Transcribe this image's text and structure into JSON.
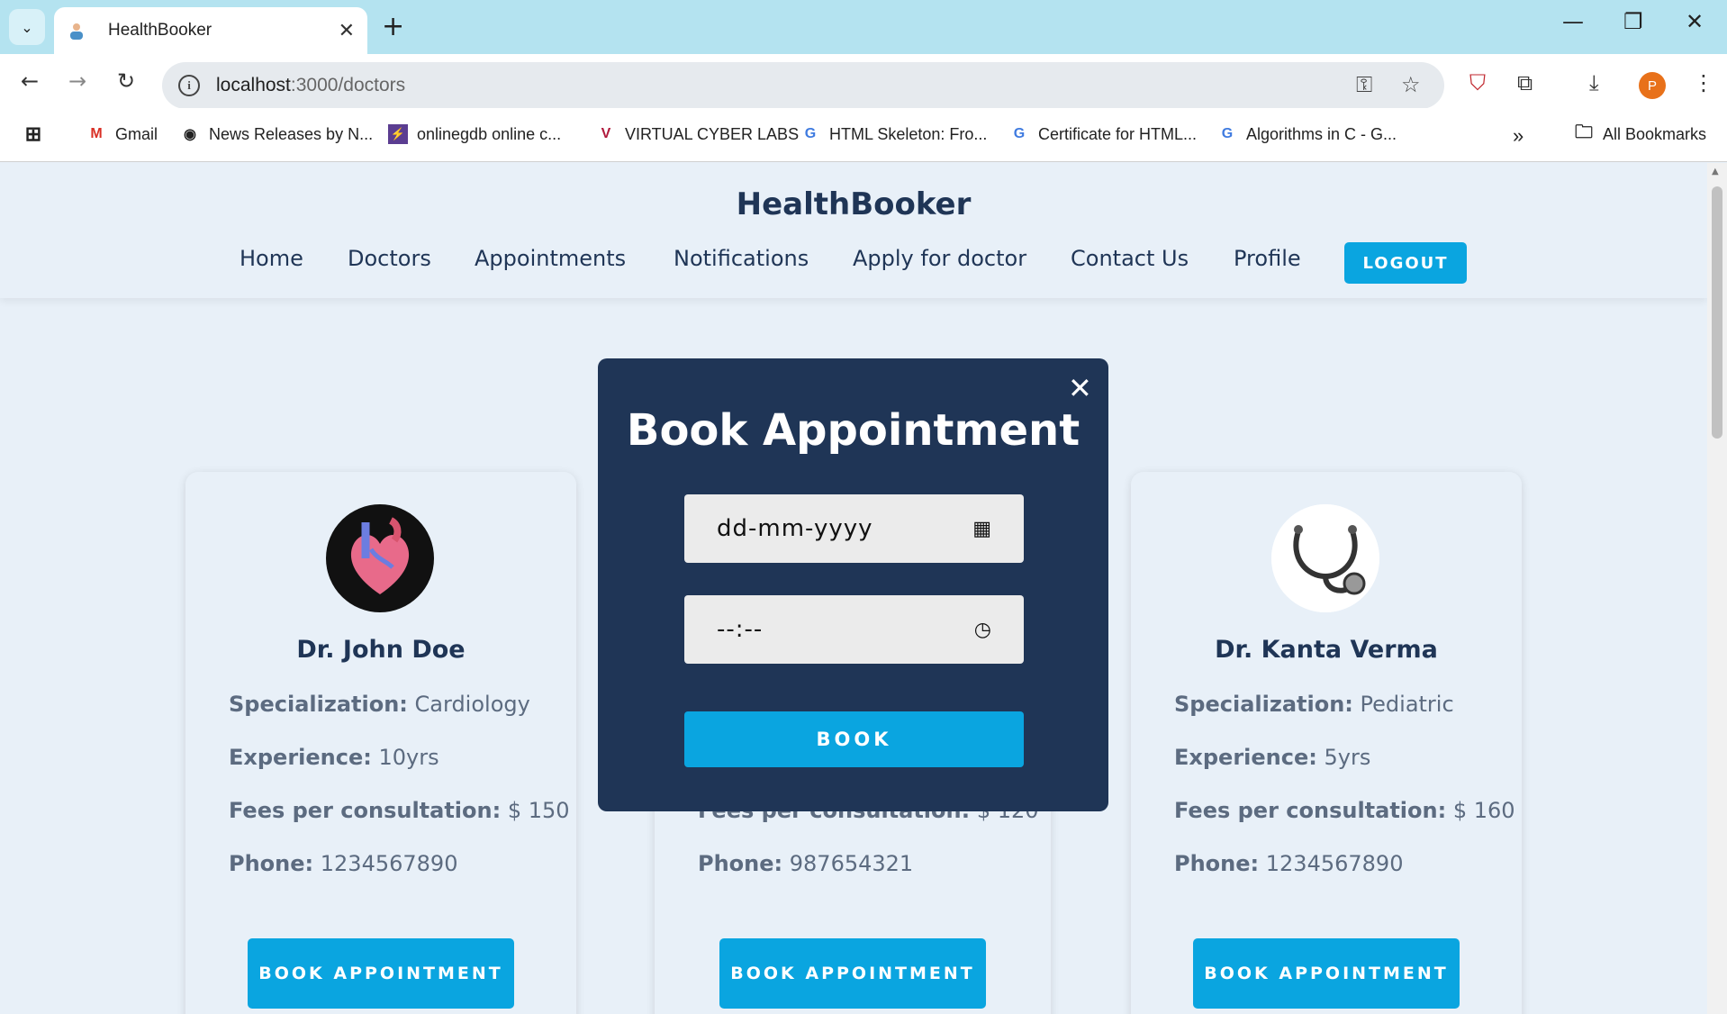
{
  "browser": {
    "tab_title": "HealthBooker",
    "new_tab": "+",
    "url_host": "localhost",
    "url_path": ":3000/doctors",
    "profile_initial": "P",
    "bookmarks": [
      {
        "label": "Gmail",
        "icon": "gmail-icon"
      },
      {
        "label": "News Releases by N...",
        "icon": "news-icon"
      },
      {
        "label": "onlinegdb online c...",
        "icon": "onlinegdb-icon"
      },
      {
        "label": "VIRTUAL CYBER LABS",
        "icon": "cyber-labs-icon"
      },
      {
        "label": "HTML Skeleton: Fro...",
        "icon": "google-icon"
      },
      {
        "label": "Certificate for HTML...",
        "icon": "google-icon"
      },
      {
        "label": "Algorithms in C - G...",
        "icon": "google-icon"
      }
    ],
    "all_bookmarks": "All Bookmarks",
    "more": "»"
  },
  "app": {
    "brand": "HealthBooker",
    "nav": [
      "Home",
      "Doctors",
      "Appointments",
      "Notifications",
      "Apply for doctor",
      "Contact Us",
      "Profile"
    ],
    "logout": "LOGOUT",
    "accent": "#0aa5e0",
    "primary": "#1f3556"
  },
  "doctors": [
    {
      "name": "Dr. John Doe",
      "specialization_label": "Specialization:",
      "specialization": "Cardiology",
      "experience_label": "Experience:",
      "experience": "10yrs",
      "fees_label": "Fees per consultation:",
      "fees": "$ 150",
      "phone_label": "Phone:",
      "phone": "1234567890",
      "button": "BOOK APPOINTMENT"
    },
    {
      "name": "",
      "specialization_label": "",
      "specialization": "",
      "experience_label": "",
      "experience": "",
      "fees_label": "Fees per consultation:",
      "fees": "$ 120",
      "phone_label": "Phone:",
      "phone": "987654321",
      "button": "BOOK APPOINTMENT"
    },
    {
      "name": "Dr. Kanta Verma",
      "specialization_label": "Specialization:",
      "specialization": "Pediatric",
      "experience_label": "Experience:",
      "experience": "5yrs",
      "fees_label": "Fees per consultation:",
      "fees": "$ 160",
      "phone_label": "Phone:",
      "phone": "1234567890",
      "button": "BOOK APPOINTMENT"
    }
  ],
  "modal": {
    "title": "Book Appointment",
    "date_placeholder": "dd-mm-yyyy",
    "time_placeholder": "--:--",
    "book": "BOOK"
  }
}
